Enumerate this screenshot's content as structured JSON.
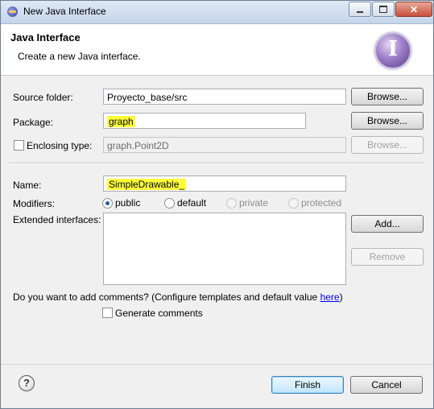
{
  "window": {
    "title": "New Java Interface",
    "controls": {
      "minimize": "minimize-icon",
      "maximize": "maximize-icon",
      "close": "close-icon"
    }
  },
  "header": {
    "title": "Java Interface",
    "subtitle": "Create a new Java interface.",
    "icon_letter": "I"
  },
  "form": {
    "source_folder": {
      "label": "Source folder:",
      "value": "Proyecto_base/src",
      "button": "Browse..."
    },
    "package": {
      "label": "Package:",
      "value": "graph",
      "button": "Browse..."
    },
    "enclosing": {
      "label": "Enclosing type:",
      "checked": false,
      "value": "graph.Point2D",
      "button": "Browse..."
    },
    "name": {
      "label": "Name:",
      "value": "SimpleDrawable_"
    },
    "modifiers": {
      "label": "Modifiers:",
      "options": [
        "public",
        "default",
        "private",
        "protected"
      ],
      "selected": "public"
    },
    "extended_interfaces": {
      "label": "Extended interfaces:",
      "add_button": "Add...",
      "remove_button": "Remove"
    },
    "comments": {
      "question": "Do you want to add comments? (Configure templates and default value ",
      "link": "here",
      "close_paren": ")",
      "generate_label": "Generate comments",
      "checked": false
    }
  },
  "footer": {
    "help_glyph": "?",
    "finish": "Finish",
    "cancel": "Cancel"
  },
  "colors": {
    "highlight": "#ffff3a",
    "link": "#0000ee",
    "default_button": "#bee6fd"
  }
}
